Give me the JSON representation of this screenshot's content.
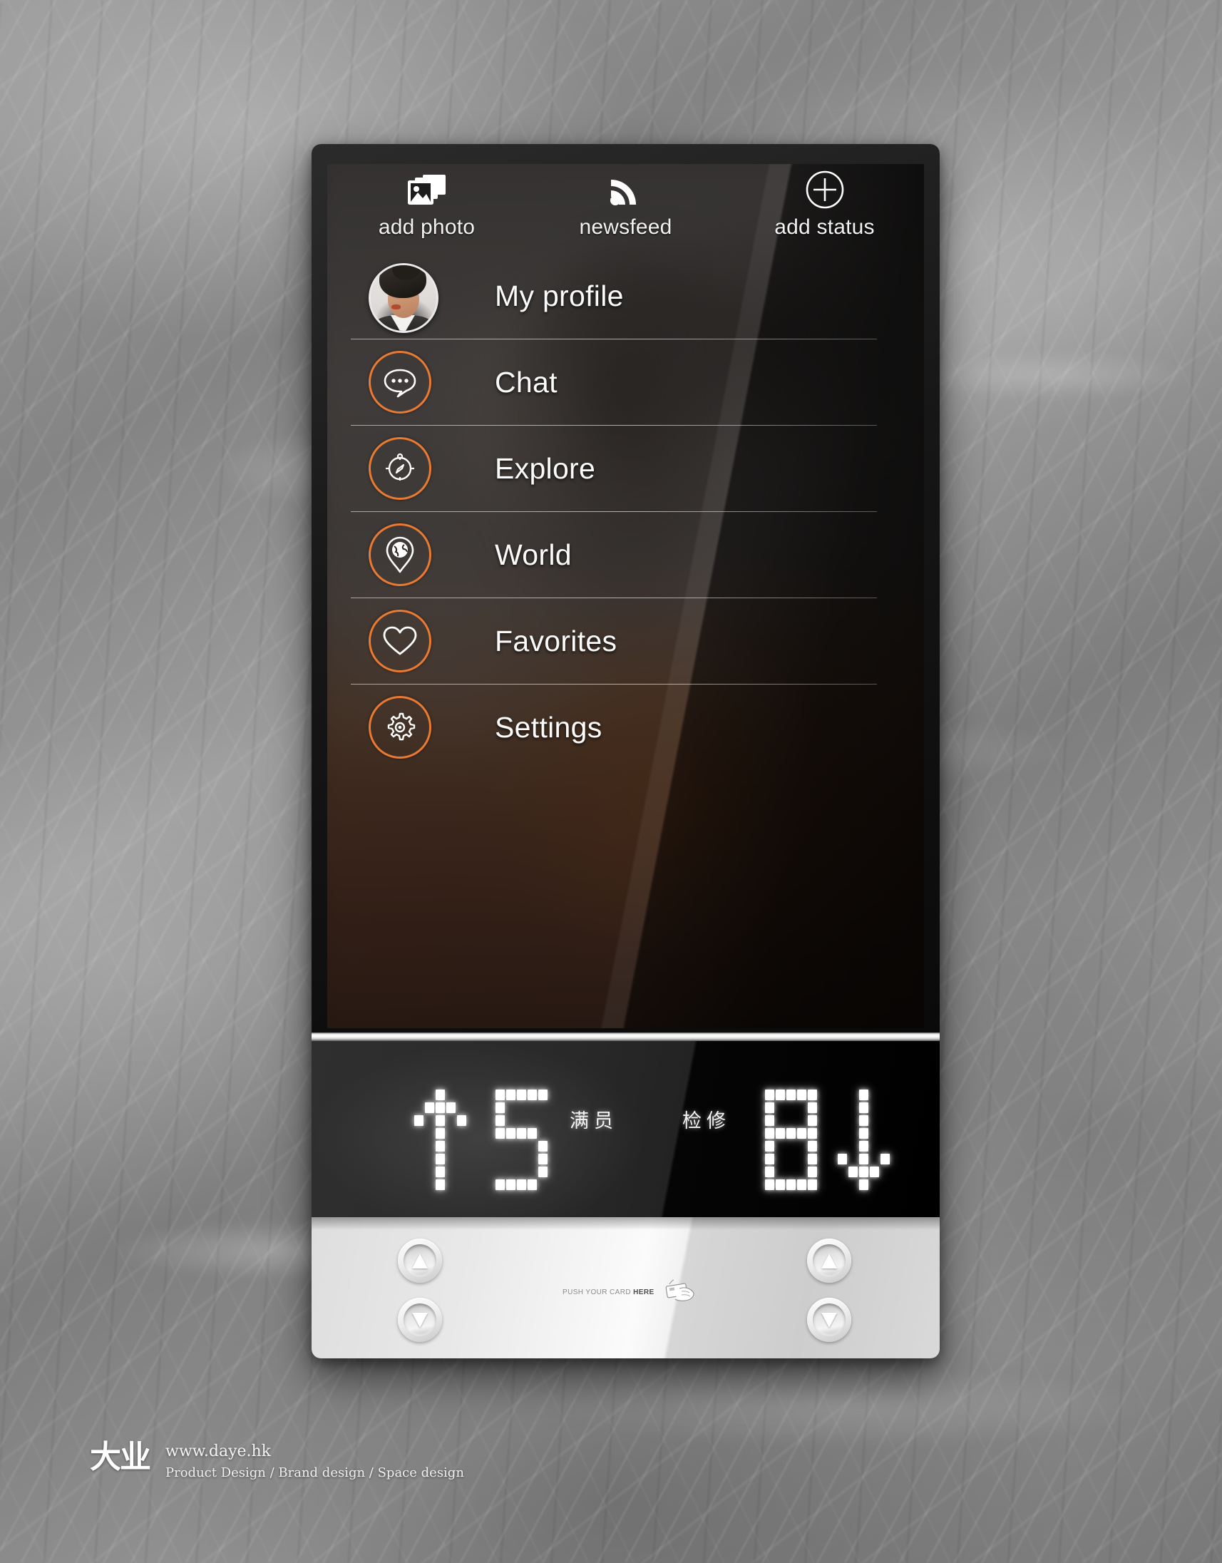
{
  "toolbar": {
    "items": [
      {
        "label": "add photo",
        "icon": "photos-stack-icon"
      },
      {
        "label": "newsfeed",
        "icon": "rss-feed-icon"
      },
      {
        "label": "add status",
        "icon": "plus-circle-icon"
      }
    ]
  },
  "menu": {
    "profile": {
      "label": "My profile",
      "icon": "avatar-photo"
    },
    "items": [
      {
        "label": "Chat",
        "icon": "chat-bubble-icon"
      },
      {
        "label": "Explore",
        "icon": "compass-icon"
      },
      {
        "label": "World",
        "icon": "map-pin-globe-icon"
      },
      {
        "label": "Favorites",
        "icon": "heart-icon"
      },
      {
        "label": "Settings",
        "icon": "gear-icon"
      }
    ]
  },
  "led_display": {
    "left": {
      "direction": "up",
      "floor": "5",
      "status": "满员"
    },
    "right": {
      "status": "检修",
      "floor": "8",
      "direction": "down"
    }
  },
  "call_panel": {
    "left": {
      "up": "▲",
      "down": "▼"
    },
    "right": {
      "up": "▲",
      "down": "▼"
    },
    "card_hint_prefix": "PUSH YOUR CARD ",
    "card_hint_emphasis": "HERE",
    "card_icon": "card-swipe-hand-icon"
  },
  "branding": {
    "mark": "大业",
    "url": "www.daye.hk",
    "services": "Product Design  /  Brand design  /  Space design"
  },
  "colors": {
    "accent_orange": "#ea7a31",
    "screen_text": "#fbfbfb",
    "led_white": "#ffffff"
  }
}
